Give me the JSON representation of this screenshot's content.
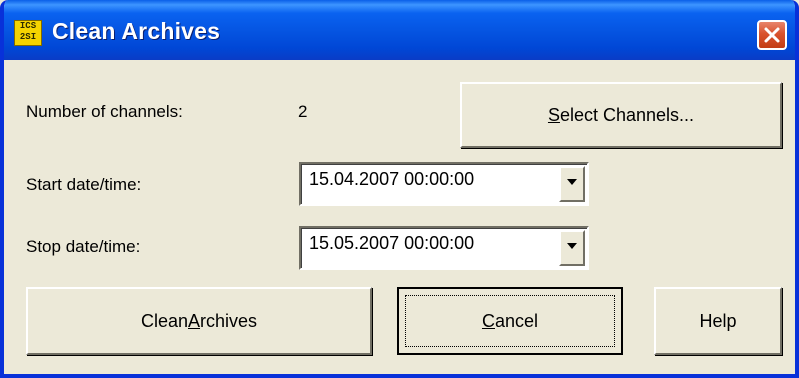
{
  "window": {
    "title": "Clean Archives",
    "icon_text": "ICS 2SI",
    "close_icon": "close-icon"
  },
  "form": {
    "channels_label": "Number of channels:",
    "channels_value": "2",
    "start_label": "Start date/time:",
    "start_value": "15.04.2007 00:00:00",
    "stop_label": "Stop date/time:",
    "stop_value": "15.05.2007 00:00:00"
  },
  "buttons": {
    "select_channels": {
      "pre": "",
      "accel": "S",
      "post": "elect Channels..."
    },
    "clean_archives": {
      "pre": "Clean ",
      "accel": "A",
      "post": "rchives"
    },
    "cancel": {
      "pre": "",
      "accel": "C",
      "post": "ancel"
    },
    "help": "Help"
  },
  "colors": {
    "titlebar": "#0553e0",
    "window_bg": "#ece9d8",
    "close_button": "#d9532e"
  }
}
